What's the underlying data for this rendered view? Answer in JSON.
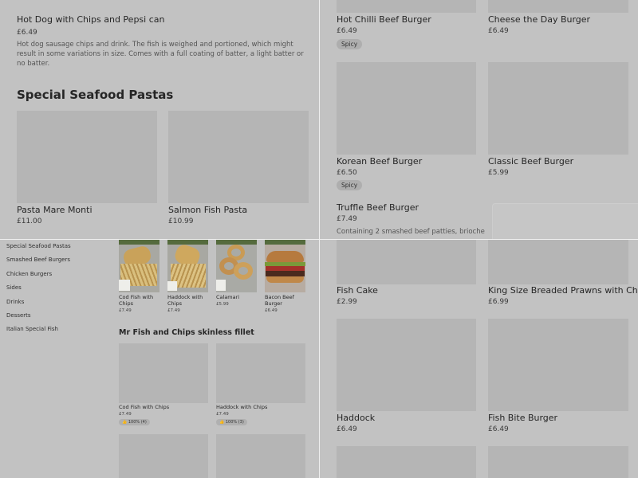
{
  "q1": {
    "hotdog": {
      "name": "Hot Dog with Chips and Pepsi can",
      "price": "£6.49",
      "desc": "Hot dog sausage chips and drink. The fish is weighed and portioned, which might result in some variations in size. Comes with a full coating of batter, a light batter or no batter."
    },
    "section_title": "Special Seafood Pastas",
    "items": [
      {
        "name": "Pasta Mare Monti",
        "price": "£11.00"
      },
      {
        "name": "Salmon Fish Pasta",
        "price": "£10.99"
      }
    ]
  },
  "q2": {
    "items": [
      {
        "name": "Hot Chilli Beef Burger",
        "price": "£6.49",
        "tag": "Spicy"
      },
      {
        "name": "Cheese the Day Burger",
        "price": "£6.49"
      },
      {
        "name": "Korean Beef Burger",
        "price": "£6.50",
        "tag": "Spicy"
      },
      {
        "name": "Classic Beef Burger",
        "price": "£5.99"
      }
    ],
    "truffle": {
      "name": "Truffle Beef Burger",
      "price": "£7.49",
      "desc": "Containing 2 smashed beef patties, brioche"
    }
  },
  "q3": {
    "sidebar": [
      "Special Seafood Pastas",
      "Smashed Beef Burgers",
      "Chicken Burgers",
      "Sides",
      "Drinks",
      "Desserts",
      "Italian Special Fish"
    ],
    "top_items": [
      {
        "name": "Cod Fish with Chips",
        "price": "£7.49"
      },
      {
        "name": "Haddock with Chips",
        "price": "£7.49"
      },
      {
        "name": "Calamari",
        "price": "£5.99"
      },
      {
        "name": "Bacon Beef Burger",
        "price": "£6.49"
      }
    ],
    "section_title": "Mr Fish and Chips skinless fillet",
    "section_items": [
      {
        "name": "Cod Fish with Chips",
        "price": "£7.49",
        "badge": "100% (4)"
      },
      {
        "name": "Haddock with Chips",
        "price": "£7.49",
        "badge": "100% (3)"
      }
    ]
  },
  "q4": {
    "items": [
      {
        "name": "Fish Cake",
        "price": "£2.99"
      },
      {
        "name": "King Size Breaded Prawns with Chips",
        "price": "£6.99"
      },
      {
        "name": "Haddock",
        "price": "£6.49"
      },
      {
        "name": "Fish Bite Burger",
        "price": "£6.49"
      }
    ]
  },
  "icons": {
    "thumb": "thumbs-up-icon"
  }
}
